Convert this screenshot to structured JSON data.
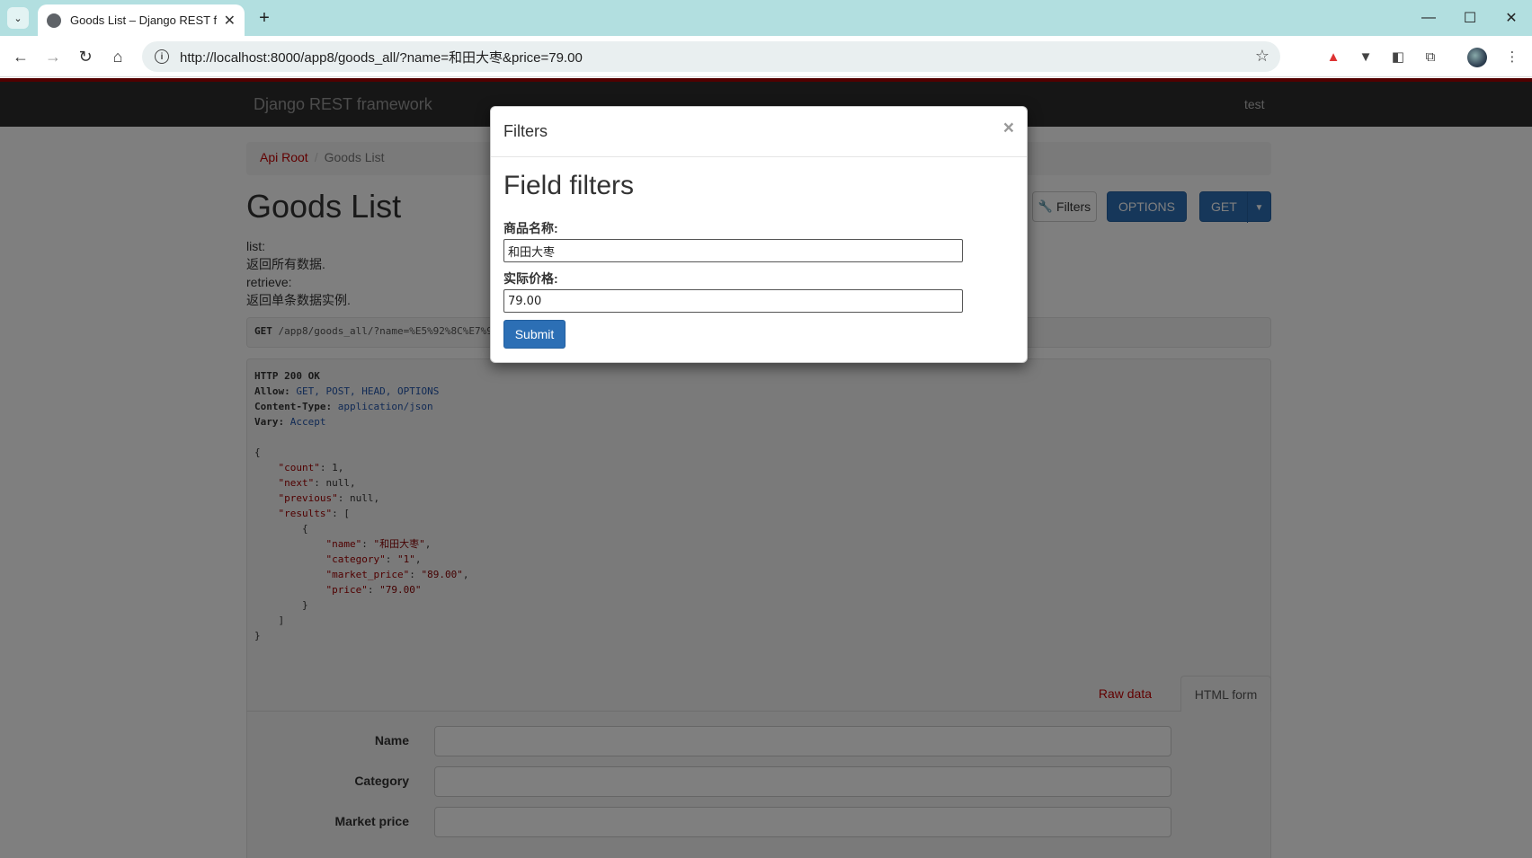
{
  "browser": {
    "tab_title": "Goods List – Django REST fra",
    "url": "http://localhost:8000/app8/goods_all/?name=和田大枣&price=79.00",
    "icons": [
      "tab-search-icon",
      "globe-favicon-icon",
      "close-icon",
      "plus-icon",
      "minimize-icon",
      "maximize-icon",
      "close-window-icon",
      "back-icon",
      "forward-icon",
      "reload-icon",
      "home-icon",
      "site-info-icon",
      "star-icon",
      "extension-icon",
      "profile-avatar",
      "more-menu-icon"
    ]
  },
  "navbar": {
    "brand": "Django REST framework",
    "user": "test"
  },
  "breadcrumb": {
    "root": "Api Root",
    "separator": "/",
    "current": "Goods List"
  },
  "page": {
    "title": "Goods List",
    "description": [
      "list:",
      "返回所有数据.",
      "retrieve:",
      "返回单条数据实例."
    ]
  },
  "buttons": {
    "filters": "Filters",
    "options": "OPTIONS",
    "get": "GET"
  },
  "request": {
    "method": "GET",
    "path": "/app8/goods_all/?name=%E5%92%8C%E7%94"
  },
  "response": {
    "status_line": "HTTP 200 OK",
    "headers": [
      {
        "key": "Allow:",
        "value": "GET, POST, HEAD, OPTIONS"
      },
      {
        "key": "Content-Type:",
        "value": "application/json"
      },
      {
        "key": "Vary:",
        "value": "Accept"
      }
    ],
    "body": {
      "count_key": "\"count\"",
      "count_val": "1",
      "next_key": "\"next\"",
      "next_val": "null",
      "previous_key": "\"previous\"",
      "previous_val": "null",
      "results_key": "\"results\"",
      "item": {
        "name_key": "\"name\"",
        "name_val": "\"和田大枣\"",
        "category_key": "\"category\"",
        "category_val": "\"1\"",
        "market_price_key": "\"market_price\"",
        "market_price_val": "\"89.00\"",
        "price_key": "\"price\"",
        "price_val": "\"79.00\""
      }
    }
  },
  "content_tabs": {
    "raw": "Raw data",
    "html": "HTML form"
  },
  "form": {
    "fields": [
      "Name",
      "Category",
      "Market price"
    ]
  },
  "modal": {
    "title": "Filters",
    "close": "×",
    "heading": "Field filters",
    "name_label": "商品名称:",
    "name_value": "和田大枣",
    "price_label": "实际价格:",
    "price_value": "79.00",
    "submit": "Submit"
  },
  "colors": {
    "brand_red": "#a30000",
    "link_red": "#c20000",
    "primary_blue": "#2c6fb5",
    "navbar_bg": "#2c2c2c",
    "tabbar_bg": "#b2dfe0"
  }
}
